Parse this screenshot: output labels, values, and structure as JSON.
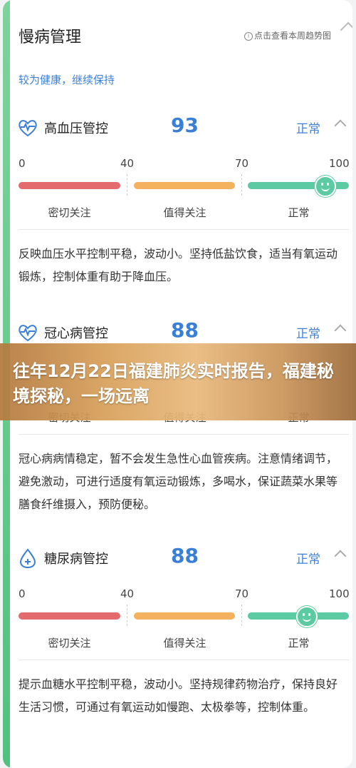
{
  "header": {
    "title": "慢病管理",
    "hint": "点击查看本周趋势图",
    "summary": "较为健康，继续保持"
  },
  "scale": {
    "ticks": [
      "0",
      "40",
      "70",
      "100"
    ],
    "zones": [
      "密切关注",
      "值得关注",
      "正常"
    ]
  },
  "sections": [
    {
      "title": "高血压管控",
      "score": "93",
      "status": "正常",
      "icon": "heart-pulse-icon",
      "description": "反映血压水平控制平稳，波动小。坚持低盐饮食，适当有氧运动锻炼，控制体重有助于降血压。"
    },
    {
      "title": "冠心病管控",
      "score": "88",
      "status": "正常",
      "icon": "heart-pulse-icon",
      "description": "冠心病病情稳定，暂不会发生急性心血管疾病。注意情绪调节，避免激动，可进行适度有氧运动锻炼，多喝水，保证蔬菜水果等膳食纤维摄入，预防便秘。"
    },
    {
      "title": "糖尿病管控",
      "score": "88",
      "status": "正常",
      "icon": "drop-icon",
      "description": "提示血糖水平控制平稳，波动小。坚持规律药物治疗，保持良好生活习惯，可通过有氧运动如慢跑、太极拳等，控制体重。"
    }
  ],
  "overlay": {
    "text": "往年12月22日福建肺炎实时报告，福建秘境探秘，一场远离"
  },
  "colors": {
    "accent": "#4fc27d",
    "blue": "#3a7fd6",
    "red": "#e36a6d",
    "orange": "#f4b25f",
    "green": "#5ccaa2"
  }
}
